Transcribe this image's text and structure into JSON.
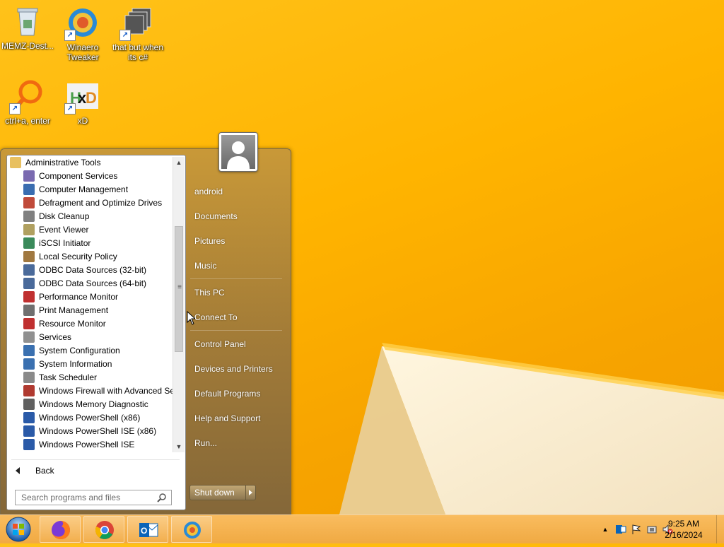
{
  "desktop": {
    "icons": [
      {
        "label": "MEMZ-Dest...",
        "icon": "recycle-bin-icon"
      },
      {
        "label": "Winaero Tweaker",
        "icon": "winaero-icon"
      },
      {
        "label": "that but when its c#",
        "icon": "shortcut-stack-icon"
      },
      {
        "label": "ctrl+a, enter",
        "icon": "magnifier-app-icon"
      },
      {
        "label": "xD",
        "icon": "hxd-icon"
      }
    ]
  },
  "start_menu": {
    "folder": "Administrative Tools",
    "programs": [
      {
        "label": "Component Services",
        "color": "#7a6ab0"
      },
      {
        "label": "Computer Management",
        "color": "#3a6db0"
      },
      {
        "label": "Defragment and Optimize Drives",
        "color": "#c04a3a"
      },
      {
        "label": "Disk Cleanup",
        "color": "#808080"
      },
      {
        "label": "Event Viewer",
        "color": "#b0a060"
      },
      {
        "label": "iSCSI Initiator",
        "color": "#3a8a5a"
      },
      {
        "label": "Local Security Policy",
        "color": "#a07840"
      },
      {
        "label": "ODBC Data Sources (32-bit)",
        "color": "#4a6a9a"
      },
      {
        "label": "ODBC Data Sources (64-bit)",
        "color": "#4a6a9a"
      },
      {
        "label": "Performance Monitor",
        "color": "#c03030"
      },
      {
        "label": "Print Management",
        "color": "#707070"
      },
      {
        "label": "Resource Monitor",
        "color": "#c03030"
      },
      {
        "label": "Services",
        "color": "#909090"
      },
      {
        "label": "System Configuration",
        "color": "#3a70b0"
      },
      {
        "label": "System Information",
        "color": "#3a70b0"
      },
      {
        "label": "Task Scheduler",
        "color": "#8a8a8a"
      },
      {
        "label": "Windows Firewall with Advanced Se",
        "color": "#b03a30"
      },
      {
        "label": "Windows Memory Diagnostic",
        "color": "#606060"
      },
      {
        "label": "Windows PowerShell (x86)",
        "color": "#2a5aa8"
      },
      {
        "label": "Windows PowerShell ISE (x86)",
        "color": "#2a5aa8"
      },
      {
        "label": "Windows PowerShell ISE",
        "color": "#2a5aa8"
      }
    ],
    "back_label": "Back",
    "search_placeholder": "Search programs and files",
    "right_items": {
      "user": "android",
      "documents": "Documents",
      "pictures": "Pictures",
      "music": "Music",
      "this_pc": "This PC",
      "connect_to": "Connect To",
      "control_panel": "Control Panel",
      "devices": "Devices and Printers",
      "default_programs": "Default Programs",
      "help": "Help and Support",
      "run": "Run..."
    },
    "shutdown_label": "Shut down"
  },
  "taskbar": {
    "pinned": [
      "firefox-icon",
      "chrome-icon",
      "outlook-icon",
      "edge-icon"
    ],
    "clock_time": "9:25 AM",
    "clock_date": "2/16/2024"
  }
}
